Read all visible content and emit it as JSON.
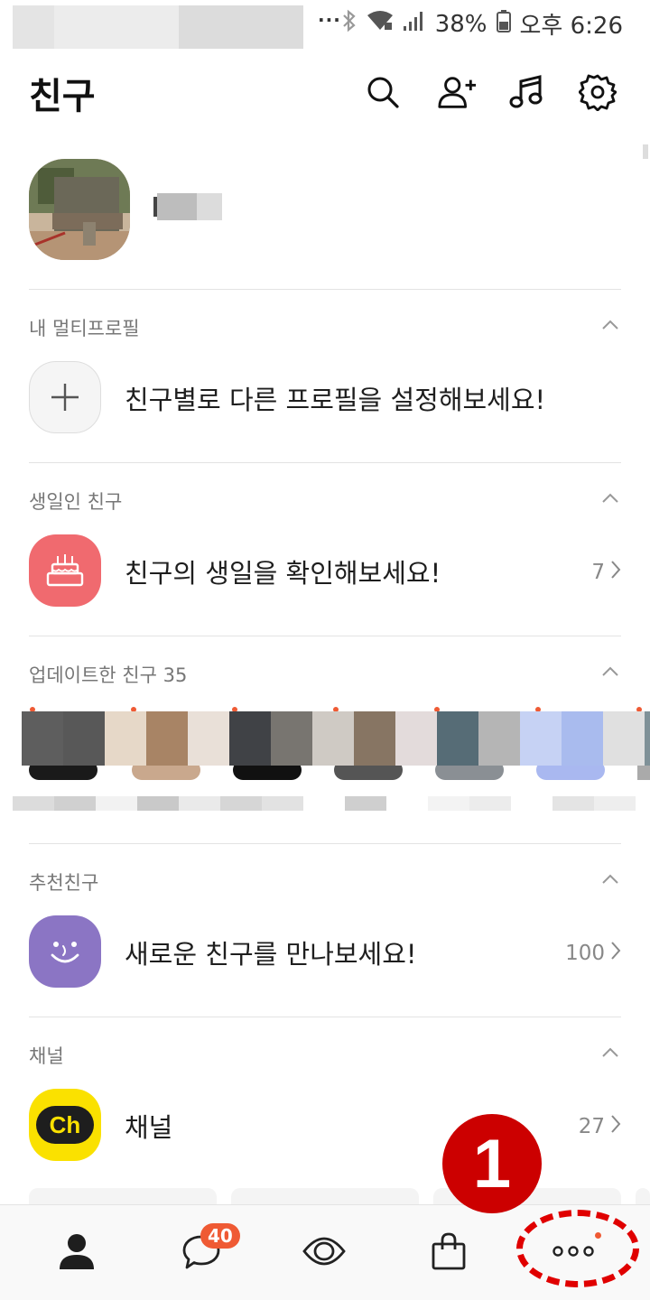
{
  "status_bar": {
    "dots": "···",
    "battery": "38%",
    "time": "오후 6:26",
    "icons": [
      "bluetooth-icon",
      "wifi-icon",
      "signal-icon",
      "battery-icon"
    ]
  },
  "header": {
    "title": "친구",
    "icons": [
      "search-icon",
      "add-friend-icon",
      "music-icon",
      "settings-icon"
    ]
  },
  "sections": {
    "multi_profile": {
      "title": "내 멀티프로필",
      "row_text": "친구별로 다른 프로필을 설정해보세요!"
    },
    "birthday": {
      "title": "생일인 친구",
      "row_text": "친구의 생일을 확인해보세요!",
      "count": "7"
    },
    "updated": {
      "title": "업데이트한 친구 35"
    },
    "recommended": {
      "title": "추천친구",
      "row_text": "새로운 친구를 만나보세요!",
      "count": "100"
    },
    "channel": {
      "title": "채널",
      "row_text": "채널",
      "count": "27",
      "icon_text": "Ch"
    }
  },
  "bottom_nav": {
    "items": [
      "friends-icon",
      "chat-icon",
      "view-icon",
      "shopping-icon",
      "more-icon"
    ],
    "chat_badge": "40"
  },
  "annotation": {
    "label": "1",
    "color": "#cc0000"
  },
  "colors": {
    "birthday_bg": "#f06a6f",
    "recommend_bg": "#8b75c4",
    "channel_bg": "#fae100",
    "badge": "#ef5a34"
  }
}
